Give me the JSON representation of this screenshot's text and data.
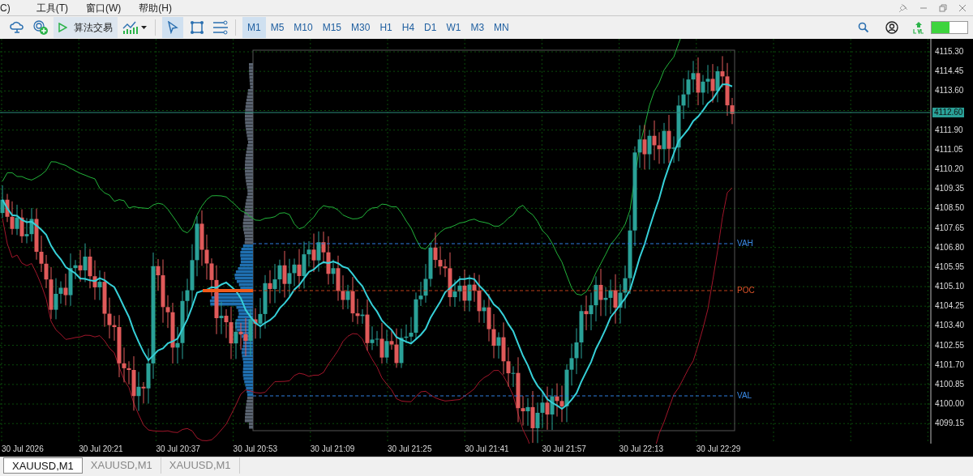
{
  "menu": [
    {
      "label": "C)"
    },
    {
      "label": "工具(T)"
    },
    {
      "label": "窗口(W)"
    },
    {
      "label": "帮助(H)"
    }
  ],
  "toolbar": {
    "algo_trading": {
      "label": "算法交易",
      "selected": true
    },
    "timeframes": [
      {
        "label": "M1",
        "selected": true
      },
      {
        "label": "M5",
        "selected": false
      },
      {
        "label": "M10",
        "selected": false
      },
      {
        "label": "M15",
        "selected": false
      },
      {
        "label": "M30",
        "selected": false
      },
      {
        "label": "H1",
        "selected": false
      },
      {
        "label": "H4",
        "selected": false
      },
      {
        "label": "D1",
        "selected": false
      },
      {
        "label": "W1",
        "selected": false
      },
      {
        "label": "M3",
        "selected": false
      },
      {
        "label": "MN",
        "selected": false
      }
    ],
    "signal_meter": {
      "level": 0.5
    }
  },
  "chart": {
    "price_labels": [
      "4115.30",
      "4114.45",
      "4113.60",
      "4111.90",
      "4111.05",
      "4110.20",
      "4109.35",
      "4108.50",
      "4107.65",
      "4106.80",
      "4105.95",
      "4105.10",
      "4104.25",
      "4103.40",
      "4102.55",
      "4101.70",
      "4100.85",
      "4100.00",
      "4099.15"
    ],
    "current_price": "4112.60",
    "time_labels": [
      "30 Jul 2026",
      "30 Jul 20:21",
      "30 Jul 20:37",
      "30 Jul 20:53",
      "30 Jul 21:09",
      "30 Jul 21:25",
      "30 Jul 21:41",
      "30 Jul 21:57",
      "30 Jul 22:13",
      "30 Jul 22:29"
    ],
    "profile_levels": [
      {
        "kind": "vah",
        "label": "VAH"
      },
      {
        "kind": "poc",
        "label": "POC"
      },
      {
        "kind": "val",
        "label": "VAL"
      }
    ]
  },
  "tabs": [
    {
      "label": "XAUUSD,M1",
      "selected": true
    },
    {
      "label": "XAUUSD,M1",
      "selected": false
    },
    {
      "label": "XAUUSD,M1",
      "selected": false
    }
  ]
}
